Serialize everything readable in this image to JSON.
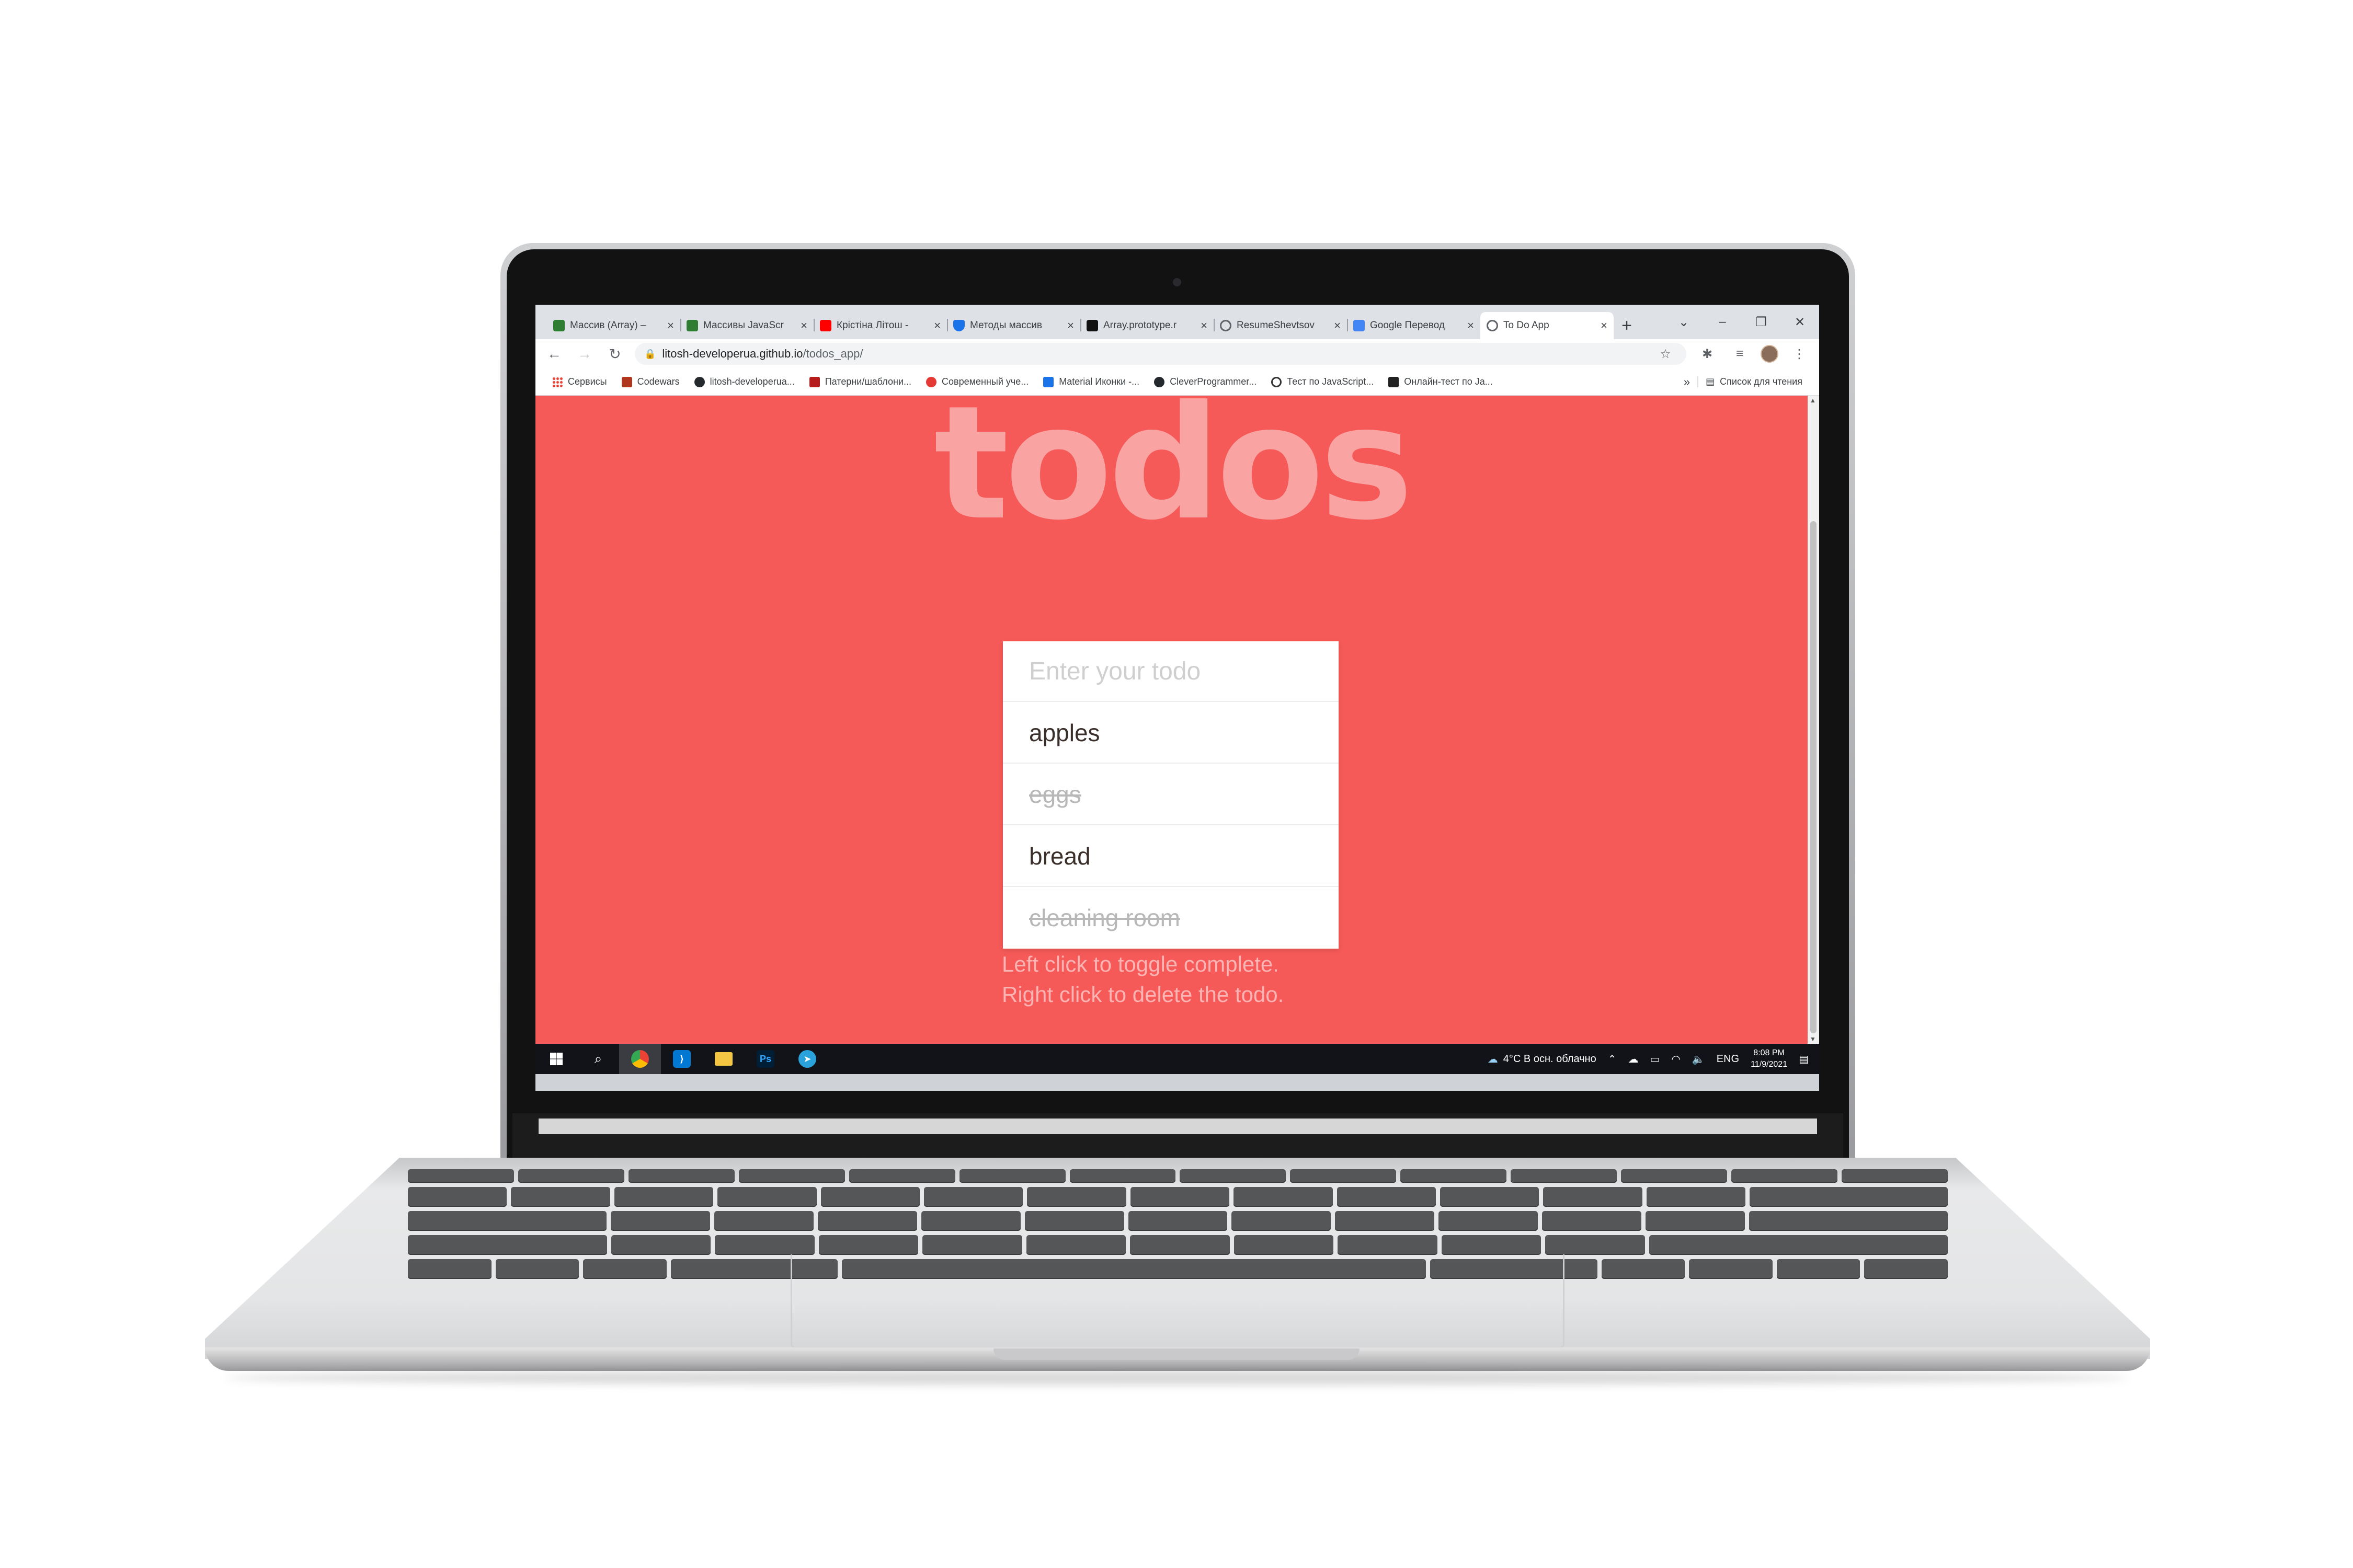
{
  "browser": {
    "tabs": [
      {
        "title": "Массив (Array) –",
        "favicon_color": "#2e7d32"
      },
      {
        "title": "Массивы JavaScr",
        "favicon_color": "#2e7d32"
      },
      {
        "title": "Крістіна Літош -",
        "favicon_color": "#ff0000"
      },
      {
        "title": "Методы массив",
        "favicon_color": "#1a73e8"
      },
      {
        "title": "Array.prototype.r",
        "favicon_color": "#111111"
      },
      {
        "title": "ResumeShevtsov",
        "favicon_color": "#5f6368"
      },
      {
        "title": "Google Перевод",
        "favicon_color": "#4285f4"
      },
      {
        "title": "To Do App",
        "favicon_color": "#5f6368"
      }
    ],
    "url_host": "litosh-developerua.github.io",
    "url_path": "/todos_app/",
    "bookmarks": [
      {
        "label": "Сервисы",
        "color": "#ea4335"
      },
      {
        "label": "Codewars",
        "color": "#b1361e"
      },
      {
        "label": "litosh-developerua...",
        "color": "#24292e"
      },
      {
        "label": "Патерни/шаблони...",
        "color": "#b71c1c"
      },
      {
        "label": "Современный уче...",
        "color": "#e53935"
      },
      {
        "label": "Material Иконки -...",
        "color": "#1a73e8"
      },
      {
        "label": "CleverProgrammer...",
        "color": "#24292e"
      },
      {
        "label": "Тест по JavaScript...",
        "color": "#333333"
      },
      {
        "label": "Онлайн-тест по Ja...",
        "color": "#222222"
      }
    ],
    "bookmarks_overflow": "»",
    "reading_list": "Список для чтения"
  },
  "app": {
    "title": "todos",
    "input_placeholder": "Enter your todo",
    "todos": [
      {
        "text": "apples",
        "completed": false
      },
      {
        "text": "eggs",
        "completed": true
      },
      {
        "text": "bread",
        "completed": false
      },
      {
        "text": "cleaning room",
        "completed": true
      }
    ],
    "hint_line1": "Left click to toggle complete.",
    "hint_line2": "Right click to delete the todo.",
    "background_color": "#f55a58"
  },
  "taskbar": {
    "weather": "4°C  В осн. облачно",
    "language": "ENG",
    "time": "8:08 PM",
    "date": "11/9/2021",
    "apps": [
      "windows-start",
      "search",
      "chrome",
      "vscode",
      "file-explorer",
      "photoshop",
      "telegram"
    ]
  }
}
